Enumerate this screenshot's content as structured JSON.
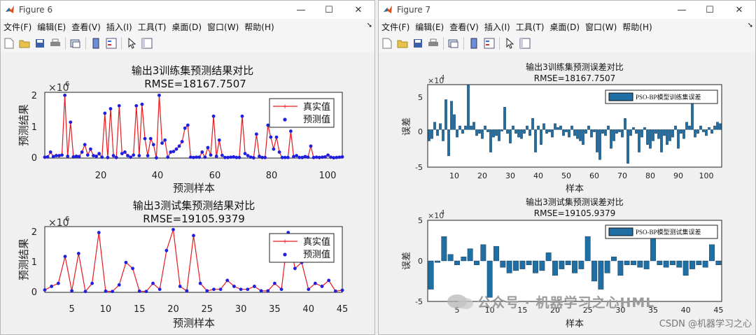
{
  "fig6": {
    "title": "Figure 6",
    "menu": [
      "文件(F)",
      "编辑(E)",
      "查看(V)",
      "插入(I)",
      "工具(T)",
      "桌面(D)",
      "窗口(W)",
      "帮助(H)"
    ],
    "top": {
      "title": "输出3训练集预测结果对比",
      "subtitle": "RMSE=18167.7507",
      "ylabel": "预测结果",
      "xlabel": "预测样本",
      "exponent": "×10",
      "exp_power": "6",
      "yticks": [
        "0",
        "1",
        "2"
      ],
      "xticks": [
        "20",
        "40",
        "60",
        "80",
        "100"
      ],
      "legend": [
        "真实值",
        "预测值"
      ]
    },
    "bottom": {
      "title": "输出3测试集预测结果对比",
      "subtitle": "RMSE=19105.9379",
      "ylabel": "预测结果",
      "xlabel": "预测样本",
      "exponent": "×10",
      "exp_power": "6",
      "yticks": [
        "0",
        "1",
        "2"
      ],
      "xticks": [
        "5",
        "10",
        "15",
        "20",
        "25",
        "30",
        "35",
        "40",
        "45"
      ],
      "legend": [
        "真实值",
        "预测值"
      ]
    }
  },
  "fig7": {
    "title": "Figure 7",
    "menu": [
      "文件(F)",
      "编辑(E)",
      "查看(V)",
      "插入(I)",
      "工具(T)",
      "桌面(D)",
      "窗口(W)",
      "帮助(H)"
    ],
    "top": {
      "title": "输出3训练集预测误差对比",
      "subtitle": "RMSE=18167.7507",
      "ylabel": "误差",
      "xlabel": "样本",
      "exponent": "×10",
      "exp_power": "4",
      "yticks": [
        "-5",
        "0",
        "5"
      ],
      "xticks": [
        "10",
        "20",
        "30",
        "40",
        "50",
        "60",
        "70",
        "80",
        "90",
        "100"
      ],
      "legend": [
        "PSO-BP模型训练集误差"
      ]
    },
    "bottom": {
      "title": "输出3测试集预测误差对比",
      "subtitle": "RMSE=19105.9379",
      "ylabel": "误差",
      "xlabel": "样本",
      "exponent": "×10",
      "exp_power": "4",
      "yticks": [
        "-5",
        "0",
        "5"
      ],
      "xticks": [
        "5",
        "10",
        "15",
        "20",
        "25",
        "30",
        "35",
        "40",
        "45"
      ],
      "legend": [
        "PSO-BP模型测试集误差"
      ]
    }
  },
  "watermark": "公众号 · 机器学习之心HML",
  "csdn": "CSDN @机器学习之心",
  "colors": {
    "true_line": "#e8191e",
    "pred_dot": "#1f1fe0",
    "bar": "#1f6fa5"
  },
  "chart_data": [
    {
      "type": "line",
      "title": "输出3训练集预测结果对比",
      "subtitle": "RMSE=18167.7507",
      "xlabel": "预测样本",
      "ylabel": "预测结果",
      "xlim": [
        1,
        105
      ],
      "ylim": [
        0,
        2200000
      ],
      "series": [
        {
          "name": "真实值",
          "values": [
            20000,
            30000,
            200000,
            50000,
            100000,
            60000,
            100000,
            2100000,
            50000,
            1200000,
            40000,
            60000,
            40000,
            200000,
            450000,
            100000,
            300000,
            80000,
            60000,
            130000,
            30000,
            1500000,
            10000,
            1650000,
            70000,
            10000,
            1750000,
            150000,
            200000,
            80000,
            20000,
            100000,
            1750000,
            80000,
            1800000,
            650000,
            80000,
            650000,
            450000,
            1000,
            2100000,
            500000,
            600000,
            20000,
            200000,
            220000,
            300000,
            400000,
            550000,
            1000000,
            1100000,
            30000,
            20000,
            30000,
            20000,
            200000,
            20000,
            350000,
            100000,
            1400000,
            50000,
            600000,
            90000,
            10000,
            10000,
            30000,
            40000,
            10000,
            20000,
            1400000,
            150000,
            80000,
            30000,
            1000,
            800000,
            50000,
            10000,
            10000,
            1100000,
            700000,
            300000,
            700000,
            200000,
            10000,
            20000,
            20000,
            900000,
            50000,
            80000,
            20000,
            10000,
            50000,
            30000,
            400000,
            10000,
            20000,
            10000,
            30000,
            40000,
            100000,
            20000,
            10000,
            20000,
            30000,
            40000
          ]
        },
        {
          "name": "预测值",
          "values": [
            30000,
            40000,
            200000,
            50000,
            80000,
            80000,
            100000,
            2100000,
            60000,
            1200000,
            40000,
            60000,
            50000,
            200000,
            450000,
            100000,
            300000,
            80000,
            60000,
            150000,
            30000,
            1500000,
            20000,
            1650000,
            80000,
            20000,
            1750000,
            150000,
            200000,
            80000,
            30000,
            100000,
            1750000,
            80000,
            1800000,
            650000,
            80000,
            650000,
            450000,
            10000,
            2100000,
            500000,
            600000,
            30000,
            200000,
            220000,
            300000,
            400000,
            550000,
            1000000,
            1100000,
            30000,
            20000,
            30000,
            30000,
            200000,
            30000,
            350000,
            100000,
            1400000,
            60000,
            600000,
            90000,
            20000,
            20000,
            30000,
            40000,
            20000,
            20000,
            1400000,
            150000,
            80000,
            30000,
            10000,
            800000,
            60000,
            20000,
            20000,
            1100000,
            700000,
            300000,
            700000,
            200000,
            20000,
            20000,
            20000,
            900000,
            50000,
            80000,
            20000,
            20000,
            50000,
            30000,
            400000,
            20000,
            30000,
            20000,
            30000,
            40000,
            100000,
            30000,
            10000,
            20000,
            30000,
            40000
          ]
        }
      ]
    },
    {
      "type": "line",
      "title": "输出3测试集预测结果对比",
      "subtitle": "RMSE=19105.9379",
      "xlabel": "预测样本",
      "ylabel": "预测结果",
      "xlim": [
        1,
        45
      ],
      "ylim": [
        0,
        2200000
      ],
      "series": [
        {
          "name": "真实值",
          "values": [
            80000,
            200000,
            300000,
            1200000,
            50000,
            1300000,
            30000,
            300000,
            2000000,
            40000,
            30000,
            250000,
            1000000,
            800000,
            40000,
            30000,
            300000,
            100000,
            1400000,
            2100000,
            200000,
            50000,
            1900000,
            300000,
            50000,
            100000,
            100000,
            400000,
            200000,
            100000,
            100000,
            200000,
            50000,
            50000,
            300000,
            100000,
            2000000,
            800000,
            1000000,
            100000,
            300000,
            200000,
            400000,
            40000,
            70000
          ]
        },
        {
          "name": "预测值",
          "values": [
            80000,
            200000,
            300000,
            1200000,
            50000,
            1300000,
            30000,
            300000,
            2000000,
            40000,
            30000,
            250000,
            1000000,
            800000,
            40000,
            30000,
            300000,
            100000,
            1400000,
            2100000,
            200000,
            50000,
            1900000,
            300000,
            50000,
            100000,
            100000,
            400000,
            200000,
            100000,
            100000,
            200000,
            50000,
            50000,
            300000,
            100000,
            2000000,
            800000,
            1000000,
            100000,
            300000,
            200000,
            400000,
            40000,
            70000
          ]
        }
      ]
    },
    {
      "type": "bar",
      "title": "输出3训练集预测误差对比",
      "subtitle": "RMSE=18167.7507",
      "xlabel": "样本",
      "ylabel": "误差",
      "xlim": [
        1,
        105
      ],
      "ylim": [
        -50000,
        60000
      ],
      "series": [
        {
          "name": "PSO-BP模型训练集误差",
          "values": [
            -15000,
            -12000,
            10000,
            -8000,
            8000,
            -15000,
            40000,
            -35000,
            38000,
            20000,
            -10000,
            5000,
            -5000,
            5000,
            60000,
            5000,
            10000,
            -8000,
            -5000,
            -12000,
            5000,
            -3000,
            -30000,
            -10000,
            -8000,
            -15000,
            -2000,
            30000,
            -5000,
            -18000,
            5000,
            -5000,
            -10000,
            -12000,
            -5000,
            5000,
            -8000,
            15000,
            -30000,
            5000,
            -20000,
            8000,
            -5000,
            -3000,
            -10000,
            8000,
            3000,
            5000,
            -8000,
            -3000,
            -10000,
            5000,
            -8000,
            -12000,
            -15000,
            -20000,
            -5000,
            5000,
            -10000,
            -3000,
            -30000,
            -40000,
            -5000,
            -8000,
            5000,
            -25000,
            -15000,
            -5000,
            -3000,
            -10000,
            15000,
            -45000,
            -8000,
            3000,
            -5000,
            -30000,
            -10000,
            3000,
            -20000,
            -25000,
            -15000,
            -5000,
            -12000,
            -30000,
            -8000,
            -20000,
            -15000,
            -10000,
            5000,
            -25000,
            -5000,
            -12000,
            10000,
            5000,
            35000,
            -10000,
            -5000,
            5000,
            -3000,
            -8000,
            3000,
            -5000,
            5000,
            10000,
            8000
          ]
        }
      ]
    },
    {
      "type": "bar",
      "title": "输出3测试集预测误差对比",
      "subtitle": "RMSE=19105.9379",
      "xlabel": "样本",
      "ylabel": "误差",
      "xlim": [
        1,
        45
      ],
      "ylim": [
        -50000,
        50000
      ],
      "series": [
        {
          "name": "PSO-BP模型测试集误差",
          "values": [
            -35000,
            -2000,
            30000,
            8000,
            -5000,
            5000,
            15000,
            -5000,
            20000,
            -45000,
            18000,
            -8000,
            -15000,
            -12000,
            -10000,
            -5000,
            -15000,
            -12000,
            10000,
            -18000,
            -10000,
            -5000,
            -15000,
            -10000,
            30000,
            -25000,
            -35000,
            -15000,
            5000,
            -18000,
            -5000,
            -5000,
            -8000,
            -10000,
            35000,
            -5000,
            -8000,
            -5000,
            -8000,
            -18000,
            -10000,
            -5000,
            -8000,
            20000,
            -5000
          ]
        }
      ]
    }
  ]
}
